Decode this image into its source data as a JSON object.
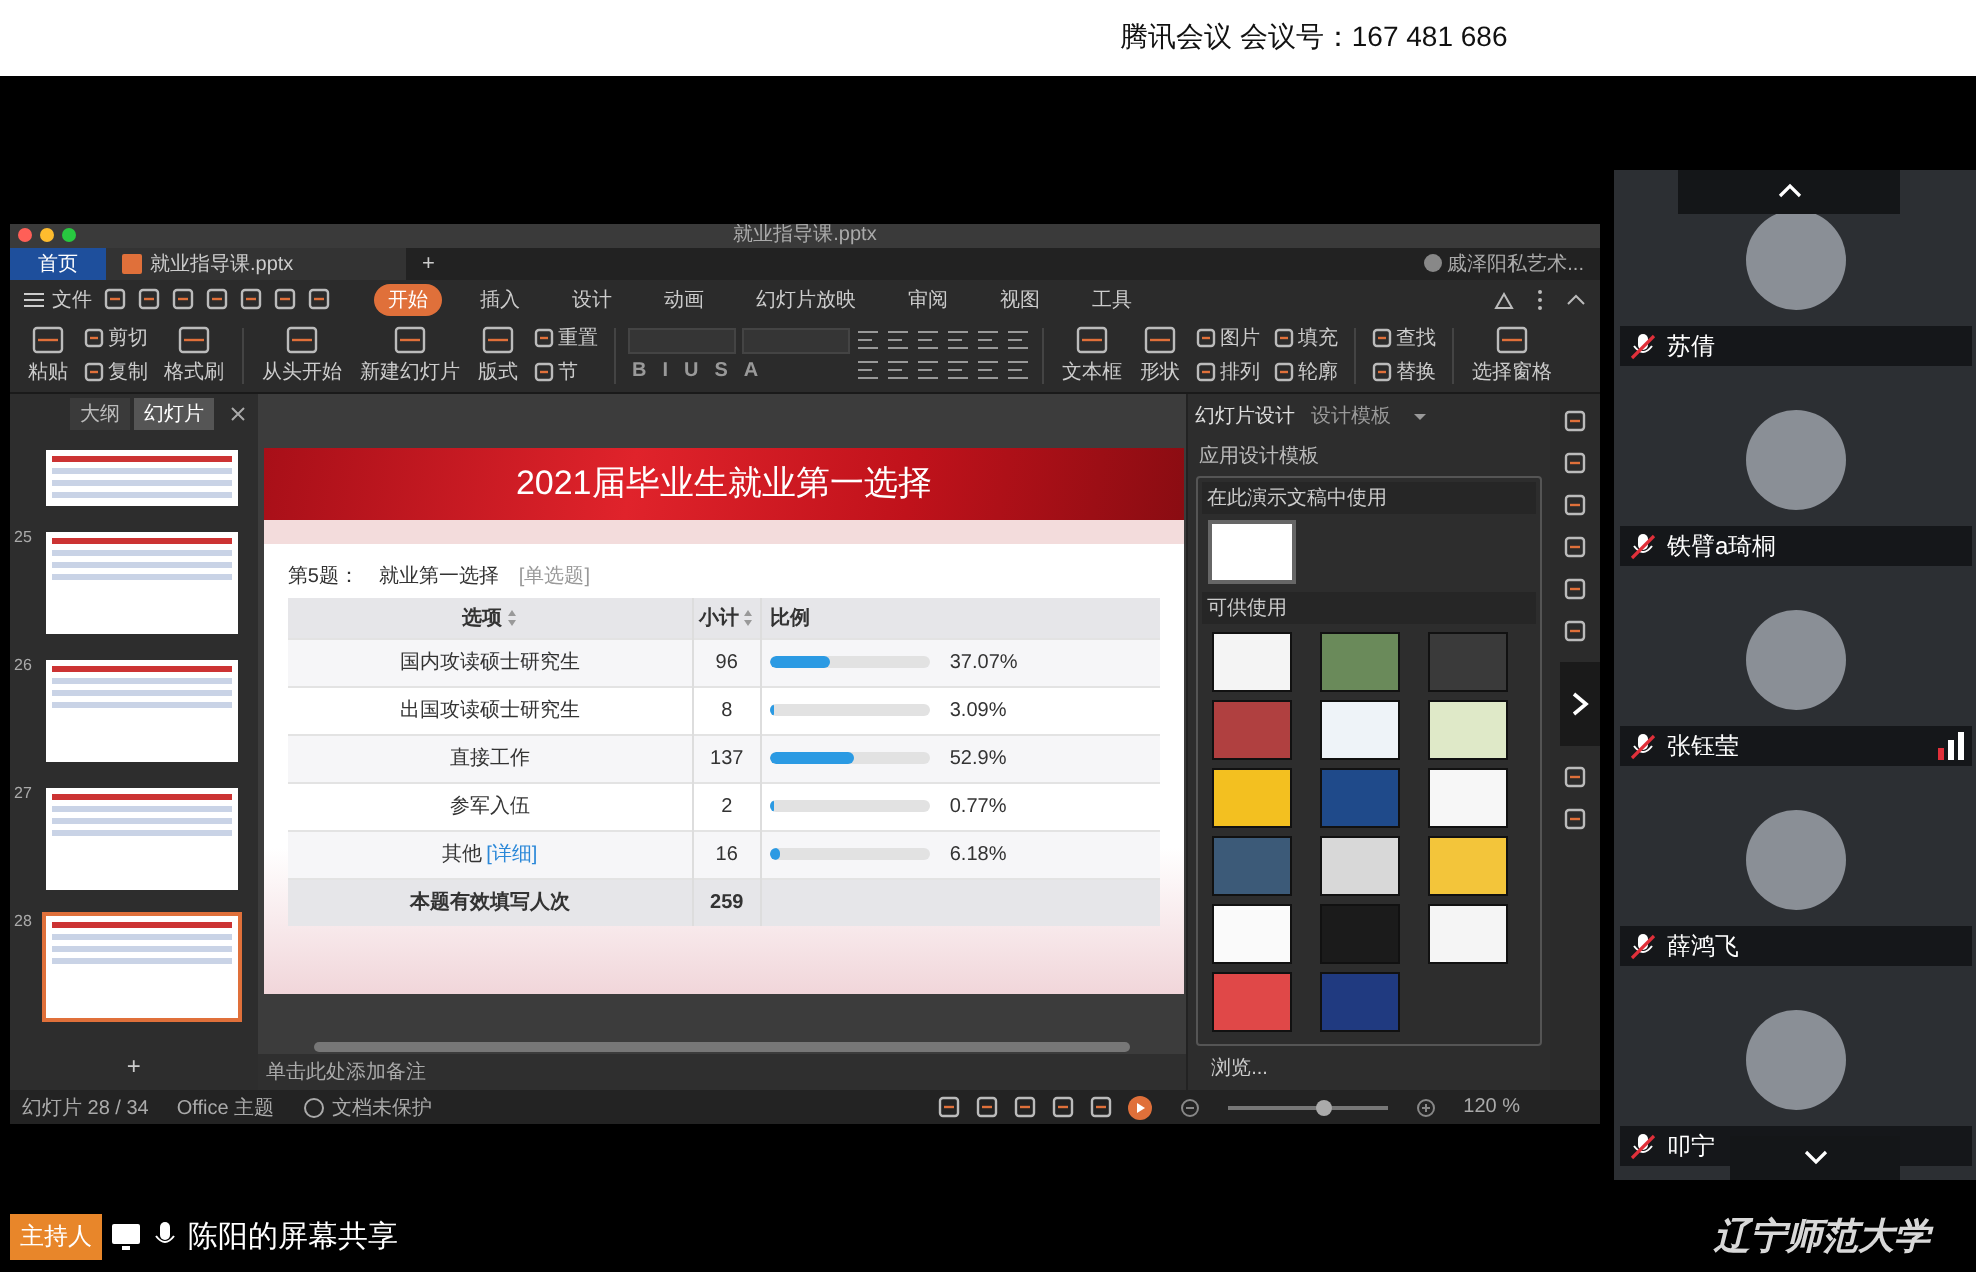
{
  "meeting_bar": {
    "title": "腾讯会议 会议号：167 481 686"
  },
  "app_window": {
    "title": "就业指导课.pptx",
    "tabs": [
      {
        "label": "首页",
        "kind": "home",
        "selected": false
      },
      {
        "label": "就业指导课.pptx",
        "kind": "document",
        "selected": true
      }
    ],
    "new_tab": "+",
    "account": "戚泽阳私艺术...",
    "menu": {
      "file": "文件",
      "tabs": [
        {
          "label": "开始",
          "selected": true
        },
        {
          "label": "插入",
          "selected": false
        },
        {
          "label": "设计",
          "selected": false
        },
        {
          "label": "动画",
          "selected": false
        },
        {
          "label": "幻灯片放映",
          "selected": false
        },
        {
          "label": "审阅",
          "selected": false
        },
        {
          "label": "视图",
          "selected": false
        },
        {
          "label": "工具",
          "selected": false
        }
      ]
    },
    "ribbon": [
      {
        "kind": "large",
        "label": "粘贴"
      },
      {
        "kind": "stack",
        "items": [
          "剪切",
          "复制"
        ]
      },
      {
        "kind": "large",
        "label": "格式刷"
      },
      {
        "kind": "separator"
      },
      {
        "kind": "large",
        "label": "从头开始"
      },
      {
        "kind": "large",
        "label": "新建幻灯片"
      },
      {
        "kind": "large",
        "label": "版式"
      },
      {
        "kind": "stack",
        "items": [
          "重置",
          "节"
        ]
      },
      {
        "kind": "separator"
      },
      {
        "kind": "font",
        "glyphs": [
          "B",
          "I",
          "U",
          "S",
          "A"
        ]
      },
      {
        "kind": "paragraph"
      },
      {
        "kind": "separator"
      },
      {
        "kind": "large",
        "label": "文本框"
      },
      {
        "kind": "large",
        "label": "形状"
      },
      {
        "kind": "stack",
        "items": [
          "图片",
          "排列"
        ]
      },
      {
        "kind": "stack",
        "items": [
          "填充",
          "轮廓"
        ]
      },
      {
        "kind": "separator"
      },
      {
        "kind": "stack",
        "items": [
          "查找",
          "替换"
        ]
      },
      {
        "kind": "separator"
      },
      {
        "kind": "large",
        "label": "选择窗格"
      }
    ],
    "sidebar": {
      "tabs": [
        {
          "label": "大纲",
          "selected": false
        },
        {
          "label": "幻灯片",
          "selected": true
        }
      ],
      "thumbnails": [
        {
          "selected": false
        },
        {
          "number": "25",
          "selected": false
        },
        {
          "number": "26",
          "selected": false
        },
        {
          "number": "27",
          "selected": false
        },
        {
          "number": "28",
          "selected": true
        }
      ],
      "add": "+"
    },
    "slide": {
      "title": "2021届毕业生就业第一选择",
      "question_number": "第5题：",
      "question": "就业第一选择",
      "question_type": "[单选题]",
      "columns": [
        "选项",
        "小计",
        "比例"
      ],
      "rows": [
        {
          "option": "国内攻读硕士研究生",
          "count": "96",
          "level": 0.3707,
          "percent": "37.07%"
        },
        {
          "option": "出国攻读硕士研究生",
          "count": "8",
          "level": 0.0309,
          "percent": "3.09%"
        },
        {
          "option": "直接工作",
          "count": "137",
          "level": 0.529,
          "percent": "52.9%"
        },
        {
          "option": "参军入伍",
          "count": "2",
          "level": 0.0077,
          "percent": "0.77%"
        },
        {
          "option": "其他",
          "link": "[详细]",
          "count": "16",
          "level": 0.0618,
          "percent": "6.18%"
        }
      ],
      "total": {
        "label": "本题有效填写人次",
        "count": "259"
      }
    },
    "notes_placeholder": "单击此处添加备注",
    "design_pane": {
      "tabs": [
        {
          "label": "幻灯片设计",
          "selected": true
        },
        {
          "label": "设计模板",
          "selected": false
        }
      ],
      "section": "应用设计模板",
      "in_use": "在此演示文稿中使用",
      "available": "可供使用",
      "browse": "浏览..."
    },
    "status_bar": {
      "slide": "幻灯片 28 / 34",
      "theme": "Office 主题",
      "protection": "文档未保护",
      "zoom": "120 %"
    }
  },
  "participants": [
    {
      "name": "苏倩",
      "muted": true,
      "speaking": false
    },
    {
      "name": "铁臂a琦桐",
      "muted": true,
      "speaking": false
    },
    {
      "name": "张钰莹",
      "muted": true,
      "speaking": true
    },
    {
      "name": "薛鸿飞",
      "muted": true,
      "speaking": false
    },
    {
      "name": "叩宁",
      "muted": true,
      "speaking": false
    }
  ],
  "share_bar": {
    "role": "主持人",
    "label": "陈阳的屏幕共享"
  },
  "logo": "辽宁师范大学"
}
